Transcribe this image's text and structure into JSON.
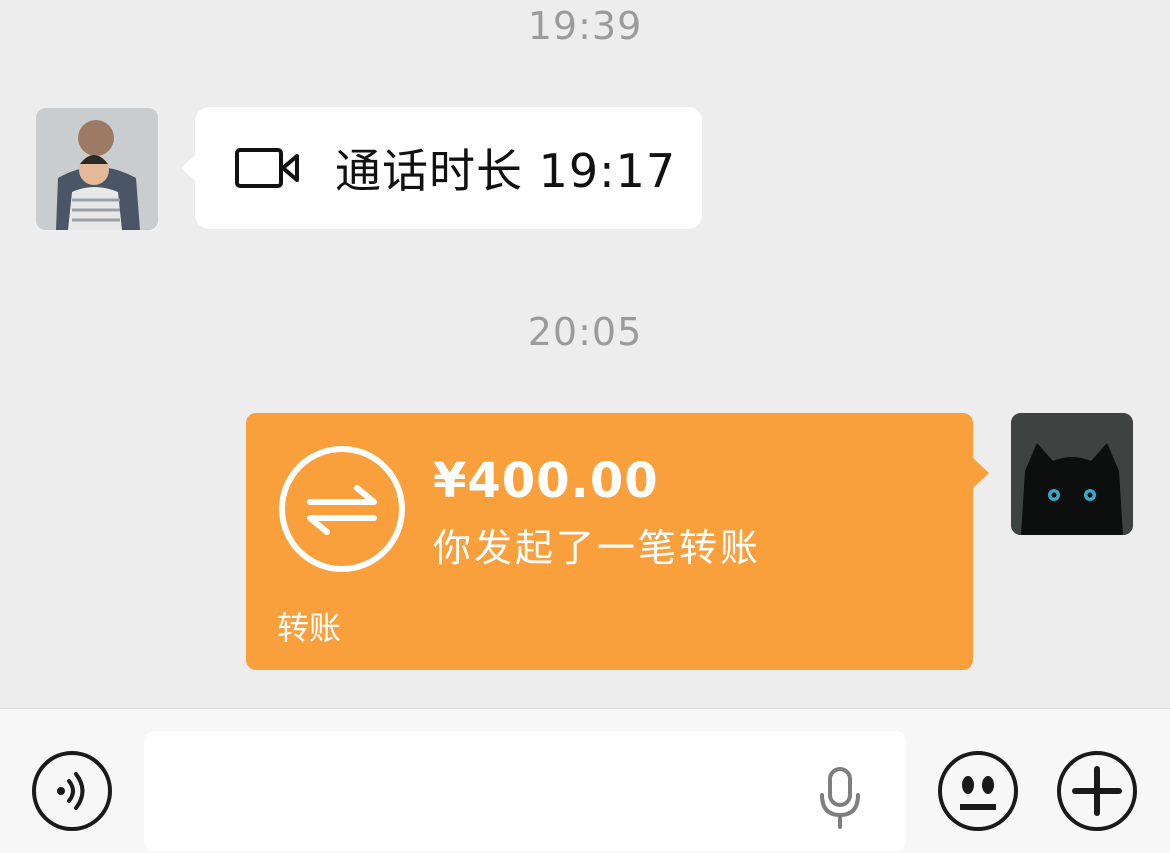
{
  "timestamps": [
    "19:39",
    "20:05"
  ],
  "call_message": {
    "icon": "video-call-icon",
    "text": "通话时长 19:17"
  },
  "transfer_message": {
    "icon": "transfer-arrows-icon",
    "amount": "¥400.00",
    "subtitle": "你发起了一笔转账",
    "footer_label": "转账",
    "color": "#f9a03d"
  },
  "input_bar": {
    "voice_button_icon": "voice-icon",
    "mic_icon": "microphone-icon",
    "emoji_button_icon": "emoji-icon",
    "plus_button_icon": "plus-icon"
  },
  "colors": {
    "background": "#ededed",
    "bubble_white": "#ffffff",
    "timestamp_text": "#9b9b9b"
  }
}
